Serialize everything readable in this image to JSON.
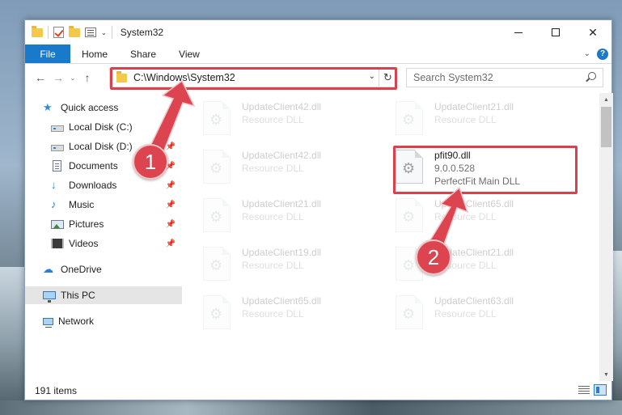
{
  "window": {
    "title": "System32",
    "controls": {
      "minimize": "—",
      "maximize": "☐",
      "close": "✕"
    }
  },
  "ribbon": {
    "tabs": [
      "File",
      "Home",
      "Share",
      "View"
    ],
    "caret": "⌄",
    "help": "?"
  },
  "address": {
    "back": "←",
    "forward": "→",
    "recent": "⌄",
    "up": "↑",
    "path": "C:\\Windows\\System32",
    "dropdown": "⌄",
    "refresh": "↻"
  },
  "search": {
    "placeholder": "Search System32"
  },
  "nav": {
    "quick_access": "Quick access",
    "items": [
      {
        "label": "Local Disk (C:)",
        "pinned": true,
        "pin": "📌"
      },
      {
        "label": "Local Disk (D:)",
        "pinned": true,
        "pin": "📌"
      },
      {
        "label": "Documents",
        "pinned": true,
        "pin": "📌"
      },
      {
        "label": "Downloads",
        "pinned": true,
        "pin": "📌"
      },
      {
        "label": "Music",
        "pinned": true,
        "pin": "📌"
      },
      {
        "label": "Pictures",
        "pinned": true,
        "pin": "📌"
      },
      {
        "label": "Videos",
        "pinned": true,
        "pin": "📌"
      }
    ],
    "onedrive": "OneDrive",
    "this_pc": "This PC",
    "network": "Network",
    "icons": {
      "star": "★",
      "download": "↓",
      "music": "♪",
      "cloud": "☁"
    }
  },
  "files": {
    "faded": [
      {
        "name": "UpdateClient42.dll",
        "desc": "Resource DLL"
      },
      {
        "name": "UpdateClient21.dll",
        "desc": "Resource DLL"
      },
      {
        "name": "UpdateClient42.dll",
        "desc": "Resource DLL"
      },
      {
        "name": "UpdateClient21.dll",
        "desc": "Resource DLL"
      },
      {
        "name": "UpdateClient65.dll",
        "desc": "Resource DLL"
      },
      {
        "name": "UpdateClient19.dll",
        "desc": "Resource DLL"
      },
      {
        "name": "UpdateClient21.dll",
        "desc": "Resource DLL"
      },
      {
        "name": "UpdateClient65.dll",
        "desc": "Resource DLL"
      },
      {
        "name": "UpdateClient63.dll",
        "desc": "Resource DLL"
      }
    ],
    "highlighted": {
      "name": "pfit90.dll",
      "version": "9.0.0.528",
      "description": "PerfectFit Main DLL"
    }
  },
  "status": {
    "item_count": "191 items"
  },
  "annotations": {
    "step1": "1",
    "step2": "2"
  },
  "colors": {
    "accent": "#1979ca",
    "highlight": "#d9424c"
  }
}
